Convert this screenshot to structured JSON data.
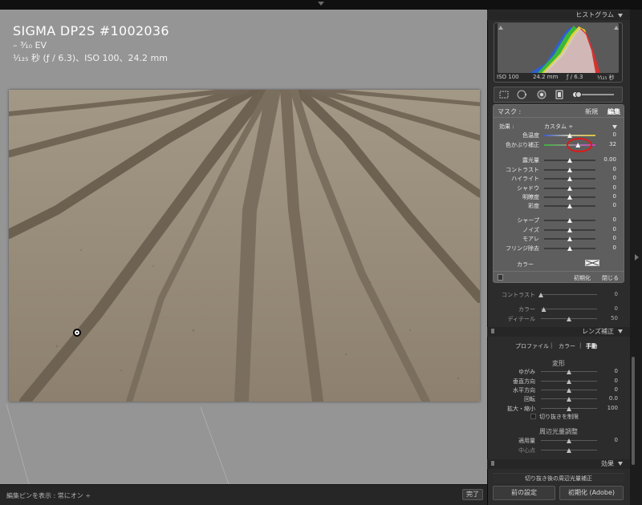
{
  "photo_info": {
    "title": "SIGMA DP2S #1002036",
    "ev": "– ³⁄₁₀ EV",
    "exposure": "¹⁄₁₂₅ 秒 (ƒ / 6.3)、ISO 100、24.2 mm"
  },
  "bottom_bar": {
    "pin_label": "編集ピンを表示 : 常にオン ÷",
    "done_label": "完了"
  },
  "histogram": {
    "header": "ヒストグラム",
    "iso": "ISO 100",
    "focal": "24.2 mm",
    "aperture": "ƒ / 6.3",
    "shutter": "¹⁄₁₂₅ 秒"
  },
  "mask": {
    "label": "マスク :",
    "new_label": "新規",
    "edit_label": "編集",
    "effect_label": "効果 :",
    "effect_value": "カスタム ÷",
    "rows": [
      {
        "label": "色温度",
        "value": "0",
        "level": 0.5,
        "kind": "temp"
      },
      {
        "label": "色かぶり補正",
        "value": "32",
        "level": 0.66,
        "kind": "tint"
      },
      {
        "label": "露光量",
        "value": "0.00",
        "level": 0.5,
        "kind": "plain"
      },
      {
        "label": "コントラスト",
        "value": "0",
        "level": 0.5,
        "kind": "plain"
      },
      {
        "label": "ハイライト",
        "value": "0",
        "level": 0.5,
        "kind": "plain"
      },
      {
        "label": "シャドウ",
        "value": "0",
        "level": 0.5,
        "kind": "plain"
      },
      {
        "label": "明瞭度",
        "value": "0",
        "level": 0.5,
        "kind": "plain"
      },
      {
        "label": "彩度",
        "value": "0",
        "level": 0.5,
        "kind": "plain"
      },
      {
        "label": "シャープ",
        "value": "0",
        "level": 0.5,
        "kind": "plain"
      },
      {
        "label": "ノイズ",
        "value": "0",
        "level": 0.5,
        "kind": "plain"
      },
      {
        "label": "モアレ",
        "value": "0",
        "level": 0.5,
        "kind": "plain"
      },
      {
        "label": "フリンジ除去",
        "value": "0",
        "level": 0.5,
        "kind": "plain"
      }
    ],
    "color_label": "カラー",
    "reset_label": "初期化",
    "close_label": "閉じる"
  },
  "below_mask": {
    "rows": [
      {
        "label": "コントラスト",
        "value": "0",
        "level": 0.0
      },
      {
        "label": "カラー",
        "value": "0",
        "level": 0.05
      },
      {
        "label": "ディテール",
        "value": "50",
        "level": 0.5
      }
    ]
  },
  "lens": {
    "header": "レンズ補正",
    "tabs": [
      "プロファイル",
      "カラー",
      "手動"
    ],
    "active_tab": "手動",
    "transform_title": "変形",
    "transform_rows": [
      {
        "label": "ゆがみ",
        "value": "0",
        "level": 0.5
      },
      {
        "label": "垂直方向",
        "value": "0",
        "level": 0.5
      },
      {
        "label": "水平方向",
        "value": "0",
        "level": 0.5
      },
      {
        "label": "回転",
        "value": "0.0",
        "level": 0.5
      },
      {
        "label": "拡大・縮小",
        "value": "100",
        "level": 0.5
      }
    ],
    "constrain_label": "切り抜きを制限",
    "vignette_title": "周辺光量調整",
    "vignette_rows": [
      {
        "label": "適用量",
        "value": "0",
        "level": 0.5
      },
      {
        "label": "中心点",
        "value": "",
        "level": 0.5
      }
    ]
  },
  "effects": {
    "header": "効果",
    "cropped_label": "切り抜き後の周辺光量補正"
  },
  "footer": {
    "prev_label": "前の設定",
    "reset_label": "初期化 (Adobe)"
  }
}
